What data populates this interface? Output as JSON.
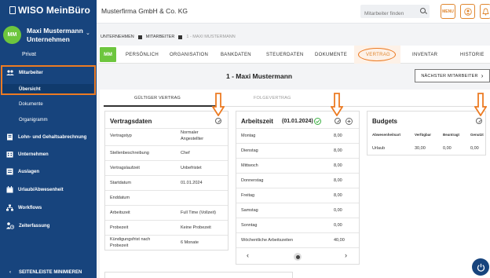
{
  "app": {
    "logo": "WISO MeinBüro",
    "company": "Musterfirma GmbH & Co. KG"
  },
  "user": {
    "initials": "MM",
    "name": "Maxi Mustermann",
    "org": "Unternehmen",
    "private": "Privat"
  },
  "sidebar": {
    "items": [
      {
        "label": "Mitarbeiter"
      },
      {
        "label": "Lohn- und Gehaltsabrechnung"
      },
      {
        "label": "Unternehmen"
      },
      {
        "label": "Auslagen"
      },
      {
        "label": "Urlaub/Abwesenheit"
      },
      {
        "label": "Workflows"
      },
      {
        "label": "Zeiterfassung"
      }
    ],
    "subitems": [
      {
        "label": "Übersicht"
      },
      {
        "label": "Dokumente"
      },
      {
        "label": "Organigramm"
      }
    ],
    "collapse_label": "SEITENLEISTE MINIMIEREN"
  },
  "topbar": {
    "search_placeholder": "Mitarbeiter finden",
    "badge": "MENU"
  },
  "breadcrumb": [
    "UNTERNEHMEN",
    "MITARBEITER",
    "1 - MAXI MUSTERMANN"
  ],
  "tabs": {
    "avatar": "MM",
    "items": [
      {
        "label": "PERSÖNLICH"
      },
      {
        "label": "ORGANISATION"
      },
      {
        "label": "BANKDATEN"
      },
      {
        "label": "STEUERDATEN"
      },
      {
        "label": "DOKUMENTE"
      },
      {
        "label": "VERTRAG"
      },
      {
        "label": "INVENTAR"
      },
      {
        "label": "HISTORIE"
      }
    ]
  },
  "page": {
    "title": "1 - Maxi Mustermann",
    "next_button": "NÄCHSTER MITARBEITER"
  },
  "subtabs": [
    "GÜLTIGER VERTRAG",
    "FOLGEVERTRAG"
  ],
  "vertragsdaten": {
    "title": "Vertragsdaten",
    "rows": [
      {
        "k": "Vertragstyp",
        "v": "Normaler",
        "v2": "Angestellter"
      },
      {
        "k": "Stellenbeschreibung",
        "v": "Chef"
      },
      {
        "k": "Vertragslaufzeit",
        "v": "Unbefristet"
      },
      {
        "k": "Startdatum",
        "v": "01.01.2024"
      },
      {
        "k": "Enddatum",
        "v": ""
      },
      {
        "k": "Arbeitszeit",
        "v": "Full Time (Vollzeit)"
      },
      {
        "k": "Probezeit",
        "v": "Keine Probezeit"
      },
      {
        "k": "Kündigungsfrist nach",
        "k2": "Probezeit",
        "v": "6 Monate"
      }
    ]
  },
  "arbeitszeit": {
    "title": "Arbeitszeit",
    "date": "(01.01.2024)",
    "rows": [
      {
        "k": "Montag",
        "v": "8,00"
      },
      {
        "k": "Dienstag",
        "v": "8,00"
      },
      {
        "k": "Mittwoch",
        "v": "8,00"
      },
      {
        "k": "Donnerstag",
        "v": "8,00"
      },
      {
        "k": "Freitag",
        "v": "8,00"
      },
      {
        "k": "Samstag",
        "v": "0,00"
      },
      {
        "k": "Sonntag",
        "v": "0,00"
      },
      {
        "k": "Wöchentliche Arbeitszeiten",
        "v": "40,00"
      }
    ]
  },
  "budgets": {
    "title": "Budgets",
    "headers": [
      "Abwesenheitsart",
      "Verfügbar",
      "Beantragt",
      "Genutzt"
    ],
    "rows": [
      {
        "art": "Urlaub",
        "verfuegbar": "30,00",
        "beantragt": "0,00",
        "genutzt": "0,00"
      }
    ]
  },
  "colors": {
    "sidebar": "#17447d",
    "accent": "#e0862e",
    "avatar": "#6dc63e"
  }
}
